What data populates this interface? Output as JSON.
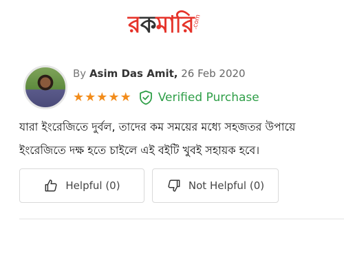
{
  "logo": {
    "part1": "র",
    "part2": "ক",
    "part3": "মারি",
    "suffix": ".com"
  },
  "review": {
    "by_label": "By",
    "reviewer_name": "Asim Das Amit,",
    "date": "26 Feb 2020",
    "rating": 5,
    "rating_max": 5,
    "verified_label": "Verified Purchase",
    "body_line1": "যারা ইংরেজিতে দুর্বল, তাদের কম সময়ের মধ্যে সহজতর উপায়ে",
    "body_line2": "ইংরেজিতে দক্ষ হতে চাইলে এই বইটি খুবই সহায়ক হবে।"
  },
  "actions": {
    "helpful_label": "Helpful (0)",
    "not_helpful_label": "Not Helpful (0)"
  },
  "colors": {
    "brand_red": "#e5332a",
    "star": "#f28c1b",
    "verified": "#2e9e47"
  },
  "icons": {
    "star": "star-icon",
    "verified": "shield-check-icon",
    "helpful": "thumbs-up-icon",
    "not_helpful": "thumbs-down-icon"
  }
}
